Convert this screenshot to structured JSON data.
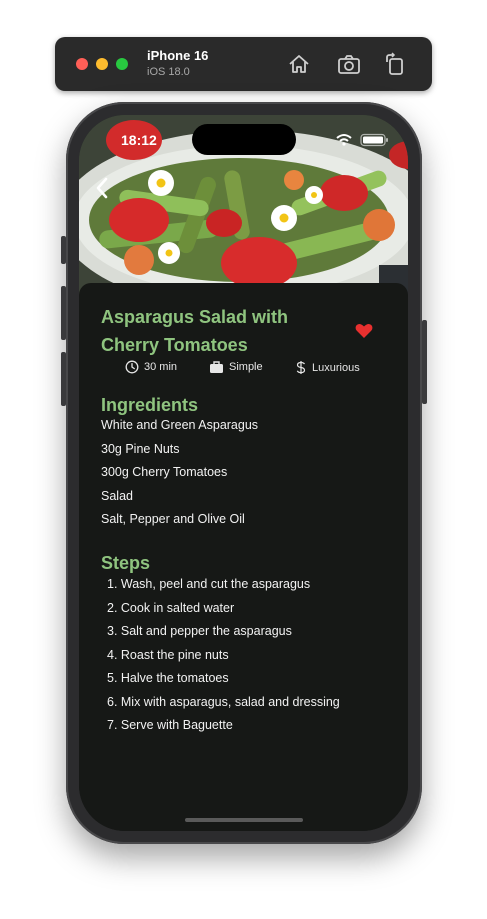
{
  "simulator": {
    "device_name": "iPhone 16",
    "os_version": "iOS 18.0"
  },
  "status_bar": {
    "time": "18:12"
  },
  "recipe": {
    "title": "Asparagus Salad with Cherry Tomatoes",
    "favorite": true,
    "duration": "30 min",
    "complexity": "Simple",
    "affordability": "Luxurious",
    "ingredients_heading": "Ingredients",
    "ingredients": [
      "White and Green Asparagus",
      "30g Pine Nuts",
      "300g Cherry Tomatoes",
      "Salad",
      "Salt, Pepper and Olive Oil"
    ],
    "steps_heading": "Steps",
    "steps": [
      "1. Wash, peel and cut the asparagus",
      "2. Cook in salted water",
      "3. Salt and pepper the asparagus",
      "4. Roast the pine nuts",
      "5. Halve the tomatoes",
      "6. Mix with asparagus, salad and dressing",
      "7. Serve with Baguette"
    ]
  },
  "colors": {
    "accent": "#8fc47f",
    "background": "#161816",
    "heart": "#e8302f"
  }
}
